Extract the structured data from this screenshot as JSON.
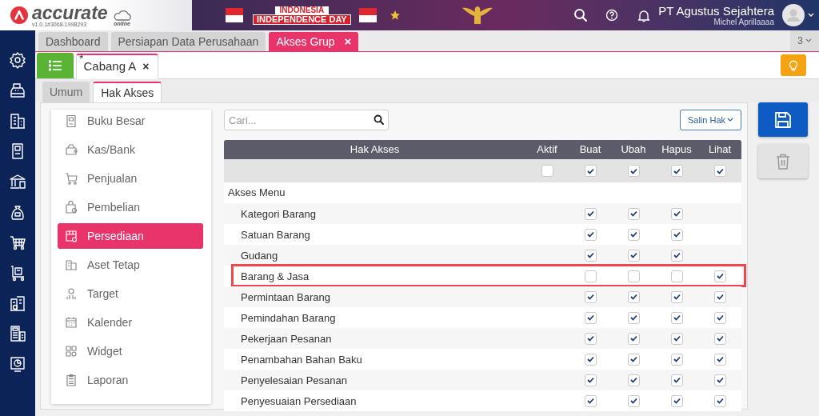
{
  "header": {
    "logo_text": "accurate",
    "logo_subtext": "online",
    "version": "v1.0.1#3068-1998293",
    "banner_line1": "INDONESIA",
    "banner_line2": "INDEPENDENCE DAY",
    "company": "PT Agustus Sejahtera",
    "user": "Michel Aprillaaaa"
  },
  "module_tabs": [
    {
      "label": "Dashboard",
      "selected": false
    },
    {
      "label": "Persiapan Data Perusahaan",
      "selected": false
    },
    {
      "label": "Akses Grup",
      "selected": true,
      "close": "×"
    }
  ],
  "tab_count": "3",
  "doc_tabs": [
    {
      "mark": "*",
      "label": "Cabang A",
      "close": "×",
      "selected": true
    }
  ],
  "sub_tabs": [
    {
      "label": "Umum",
      "selected": false
    },
    {
      "label": "Hak Akses",
      "selected": true
    }
  ],
  "menu": [
    {
      "label": "Buku Besar",
      "selected": false
    },
    {
      "label": "Kas/Bank",
      "selected": false
    },
    {
      "label": "Penjualan",
      "selected": false
    },
    {
      "label": "Pembelian",
      "selected": false
    },
    {
      "label": "Persediaan",
      "selected": true
    },
    {
      "label": "Aset Tetap",
      "selected": false
    },
    {
      "label": "Target",
      "selected": false
    },
    {
      "label": "Kalender",
      "selected": false
    },
    {
      "label": "Widget",
      "selected": false
    },
    {
      "label": "Laporan",
      "selected": false
    }
  ],
  "search": {
    "placeholder": "Cari..."
  },
  "copy_button": "Salin Hak",
  "table": {
    "columns": [
      "Hak Akses",
      "Aktif",
      "Buat",
      "Ubah",
      "Hapus",
      "Lihat"
    ],
    "select_all": {
      "aktif": false,
      "buat": true,
      "ubah": true,
      "hapus": true,
      "lihat": true
    },
    "rows": [
      {
        "kind": "section",
        "label": "Akses Menu"
      },
      {
        "kind": "item",
        "label": "Kategori Barang",
        "highlighted": false,
        "checks": {
          "buat": true,
          "ubah": true,
          "hapus": true
        }
      },
      {
        "kind": "item",
        "label": "Satuan Barang",
        "highlighted": false,
        "checks": {
          "buat": true,
          "ubah": true,
          "hapus": true
        }
      },
      {
        "kind": "item",
        "label": "Gudang",
        "highlighted": false,
        "checks": {
          "buat": true,
          "ubah": true,
          "hapus": true
        }
      },
      {
        "kind": "item",
        "label": "Barang & Jasa",
        "highlighted": true,
        "checks": {
          "buat": false,
          "ubah": false,
          "hapus": false,
          "lihat": true
        }
      },
      {
        "kind": "item",
        "label": "Permintaan Barang",
        "highlighted": false,
        "checks": {
          "buat": true,
          "ubah": true,
          "hapus": true,
          "lihat": true
        }
      },
      {
        "kind": "item",
        "label": "Pemindahan Barang",
        "highlighted": false,
        "checks": {
          "buat": true,
          "ubah": true,
          "hapus": true,
          "lihat": true
        }
      },
      {
        "kind": "item",
        "label": "Pekerjaan Pesanan",
        "highlighted": false,
        "checks": {
          "buat": true,
          "ubah": true,
          "hapus": true,
          "lihat": true
        }
      },
      {
        "kind": "item",
        "label": "Penambahan Bahan Baku",
        "highlighted": false,
        "checks": {
          "buat": true,
          "ubah": true,
          "hapus": true,
          "lihat": true
        }
      },
      {
        "kind": "item",
        "label": "Penyelesaian Pesanan",
        "highlighted": false,
        "checks": {
          "buat": true,
          "ubah": true,
          "hapus": true,
          "lihat": true
        }
      },
      {
        "kind": "item",
        "label": "Penyesuaian Persediaan",
        "highlighted": false,
        "checks": {
          "buat": true,
          "ubah": true,
          "hapus": true,
          "lihat": true
        }
      }
    ]
  }
}
